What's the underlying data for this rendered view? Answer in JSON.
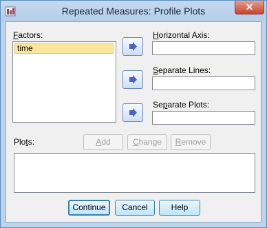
{
  "window": {
    "title": "Repeated Measures: Profile Plots",
    "close_label": "✕"
  },
  "factors": {
    "label_u": "F",
    "label_rest": "actors:",
    "items": [
      "time"
    ]
  },
  "horizontal_axis": {
    "label_u": "H",
    "label_rest": "orizontal Axis:",
    "value": ""
  },
  "separate_lines": {
    "label_u": "S",
    "label_rest": "eparate Lines:",
    "value": ""
  },
  "separate_plots": {
    "label_pre": "Se",
    "label_u": "p",
    "label_rest": "arate Plots:",
    "value": ""
  },
  "plots": {
    "label_pre": "Plo",
    "label_u": "t",
    "label_rest": "s:"
  },
  "plot_buttons": {
    "add": {
      "u": "A",
      "rest": "dd"
    },
    "change": {
      "u": "C",
      "rest": "hange"
    },
    "remove": {
      "u": "R",
      "rest": "emove"
    }
  },
  "footer": {
    "continue": "Continue",
    "cancel": "Cancel",
    "help": "Help"
  },
  "colors": {
    "arrow": "#4a63c8",
    "selection": "#fbe79c",
    "title_bar": "#bcd3ea"
  }
}
